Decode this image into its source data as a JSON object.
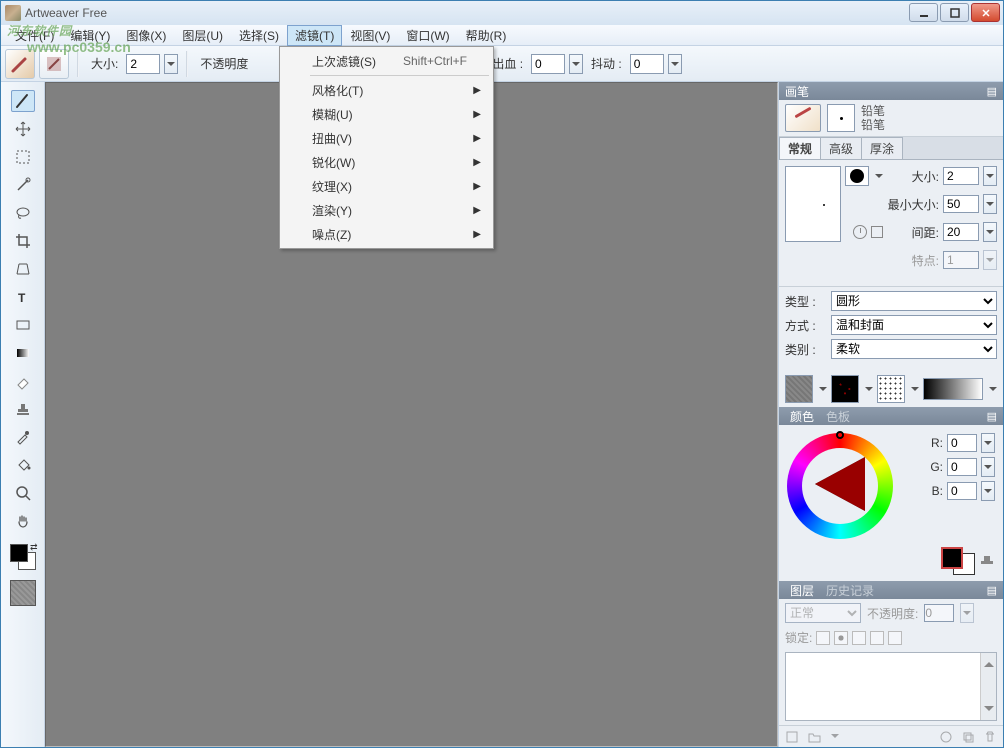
{
  "title": "Artweaver Free",
  "watermark": {
    "line1": "河东软件园",
    "line2": "www.pc0359.cn"
  },
  "menu": {
    "file": "文件(F)",
    "edit": "编辑(Y)",
    "image": "图像(X)",
    "layer": "图层(U)",
    "select": "选择(S)",
    "filter": "滤镜(T)",
    "view": "视图(V)",
    "window": "窗口(W)",
    "help": "帮助(R)"
  },
  "toolbar": {
    "size_label": "大小:",
    "size_value": "2",
    "opacity_label": "不透明度",
    "bleed_label": "出血 :",
    "bleed_value": "0",
    "jitter_label": "抖动 :",
    "jitter_value": "0"
  },
  "filter_menu": {
    "last": "上次滤镜(S)",
    "last_shortcut": "Shift+Ctrl+F",
    "stylize": "风格化(T)",
    "blur": "模糊(U)",
    "distort": "扭曲(V)",
    "sharpen": "锐化(W)",
    "texture": "纹理(X)",
    "render": "渲染(Y)",
    "noise": "噪点(Z)"
  },
  "brush_panel": {
    "title": "画笔",
    "name1": "铅笔",
    "name2": "铅笔",
    "tabs": {
      "general": "常规",
      "advanced": "高级",
      "thick": "厚涂"
    },
    "size_label": "大小:",
    "size_value": "2",
    "minsize_label": "最小大小:",
    "minsize_value": "50",
    "spacing_label": "间距:",
    "spacing_value": "20",
    "feature_label": "特点:",
    "feature_value": "1",
    "type_label": "类型 :",
    "type_value": "圆形",
    "method_label": "方式 :",
    "method_value": "温和封面",
    "category_label": "类别 :",
    "category_value": "柔软"
  },
  "color_panel": {
    "title": "颜色",
    "tab_palette": "色板",
    "r_label": "R:",
    "r_value": "0",
    "g_label": "G:",
    "g_value": "0",
    "b_label": "B:",
    "b_value": "0"
  },
  "layer_panel": {
    "title": "图层",
    "tab_history": "历史记录",
    "mode": "正常",
    "opacity_label": "不透明度:",
    "opacity_value": "0",
    "lock_label": "锁定:"
  }
}
